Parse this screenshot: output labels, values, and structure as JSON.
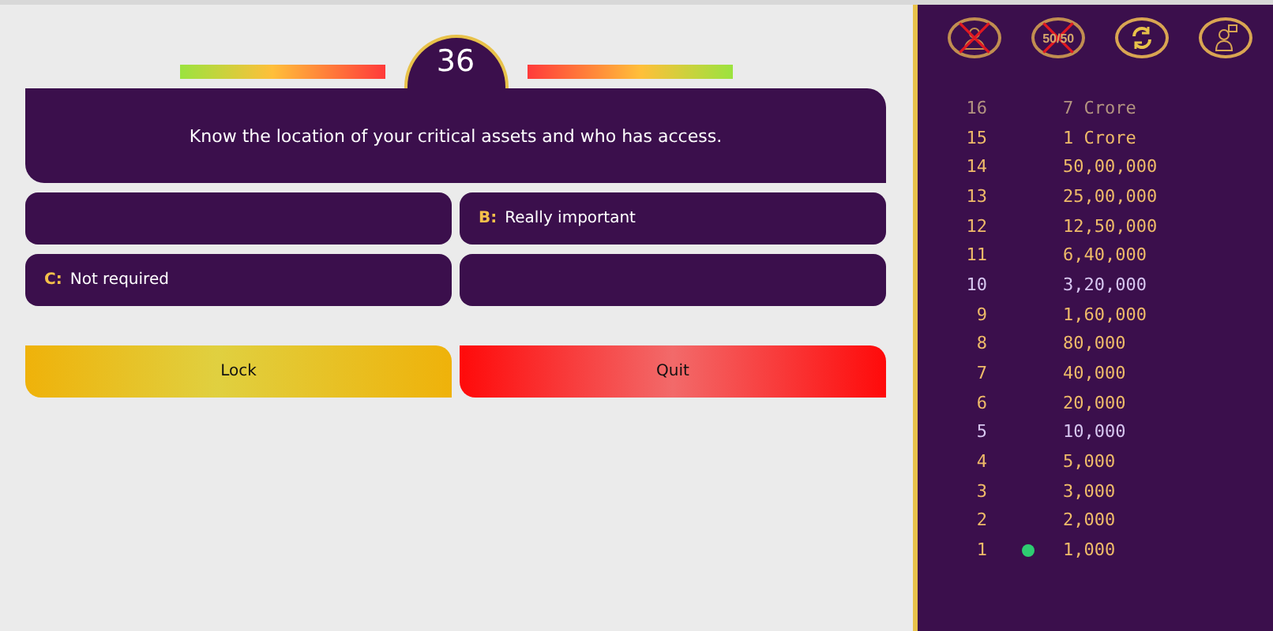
{
  "timer": "36",
  "question": "Know the location of your critical assets and who has access.",
  "options": [
    {
      "kind": "blank"
    },
    {
      "kind": "answer",
      "letter": "B:",
      "text": "Really important"
    },
    {
      "kind": "answer",
      "letter": "C:",
      "text": "Not required"
    },
    {
      "kind": "blank"
    }
  ],
  "buttons": [
    {
      "kind": "lock",
      "label": "Lock"
    },
    {
      "kind": "quit",
      "label": "Quit"
    }
  ],
  "lifelines": [
    {
      "kind": "audience",
      "used": true
    },
    {
      "kind": "fifty",
      "used": true,
      "label": "50/50"
    },
    {
      "kind": "swap",
      "used": false
    },
    {
      "kind": "expert",
      "used": false
    }
  ],
  "ladder": [
    {
      "level": "16",
      "amount": "7 Crore",
      "kind": "top",
      "current": false
    },
    {
      "level": "15",
      "amount": "1 Crore",
      "kind": "normal",
      "current": false
    },
    {
      "level": "14",
      "amount": "50,00,000",
      "kind": "normal",
      "current": false
    },
    {
      "level": "13",
      "amount": "25,00,000",
      "kind": "normal",
      "current": false
    },
    {
      "level": "12",
      "amount": "12,50,000",
      "kind": "normal",
      "current": false
    },
    {
      "level": "11",
      "amount": "6,40,000",
      "kind": "normal",
      "current": false
    },
    {
      "level": "10",
      "amount": "3,20,000",
      "kind": "milestone",
      "current": false
    },
    {
      "level": "9",
      "amount": "1,60,000",
      "kind": "normal",
      "current": false
    },
    {
      "level": "8",
      "amount": "80,000",
      "kind": "normal",
      "current": false
    },
    {
      "level": "7",
      "amount": "40,000",
      "kind": "normal",
      "current": false
    },
    {
      "level": "6",
      "amount": "20,000",
      "kind": "normal",
      "current": false
    },
    {
      "level": "5",
      "amount": "10,000",
      "kind": "milestone",
      "current": false
    },
    {
      "level": "4",
      "amount": "5,000",
      "kind": "normal",
      "current": false
    },
    {
      "level": "3",
      "amount": "3,000",
      "kind": "normal",
      "current": false
    },
    {
      "level": "2",
      "amount": "2,000",
      "kind": "normal",
      "current": false
    },
    {
      "level": "1",
      "amount": "1,000",
      "kind": "normal",
      "current": true
    }
  ]
}
